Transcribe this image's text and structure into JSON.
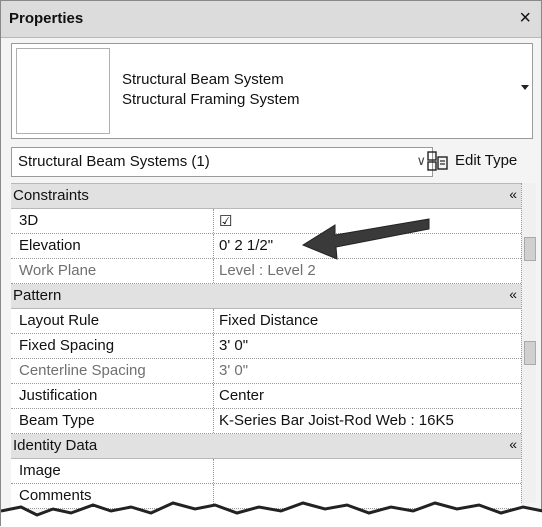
{
  "panel": {
    "title": "Properties",
    "close_glyph": "×"
  },
  "type_selector": {
    "line1": "Structural Beam System",
    "line2": "Structural Framing System"
  },
  "instance_filter": {
    "value": "Structural Beam Systems (1)"
  },
  "edit_type": {
    "label": "Edit Type"
  },
  "groups": [
    {
      "title": "Constraints",
      "rows": [
        {
          "key": "3D",
          "value": "☑"
        },
        {
          "key": "Elevation",
          "value": "0'  2 1/2\""
        },
        {
          "key": "Work Plane",
          "value": "Level : Level 2"
        }
      ]
    },
    {
      "title": "Pattern",
      "rows": [
        {
          "key": "Layout Rule",
          "value": "Fixed Distance"
        },
        {
          "key": "Fixed Spacing",
          "value": "3'  0\""
        },
        {
          "key": "Centerline Spacing",
          "value": "3'  0\""
        },
        {
          "key": "Justification",
          "value": "Center"
        },
        {
          "key": "Beam Type",
          "value": "K-Series Bar Joist-Rod Web : 16K5"
        }
      ]
    },
    {
      "title": "Identity Data",
      "rows": [
        {
          "key": "Image",
          "value": ""
        },
        {
          "key": "Comments",
          "value": ""
        }
      ]
    }
  ],
  "collapse_glyph": "«"
}
